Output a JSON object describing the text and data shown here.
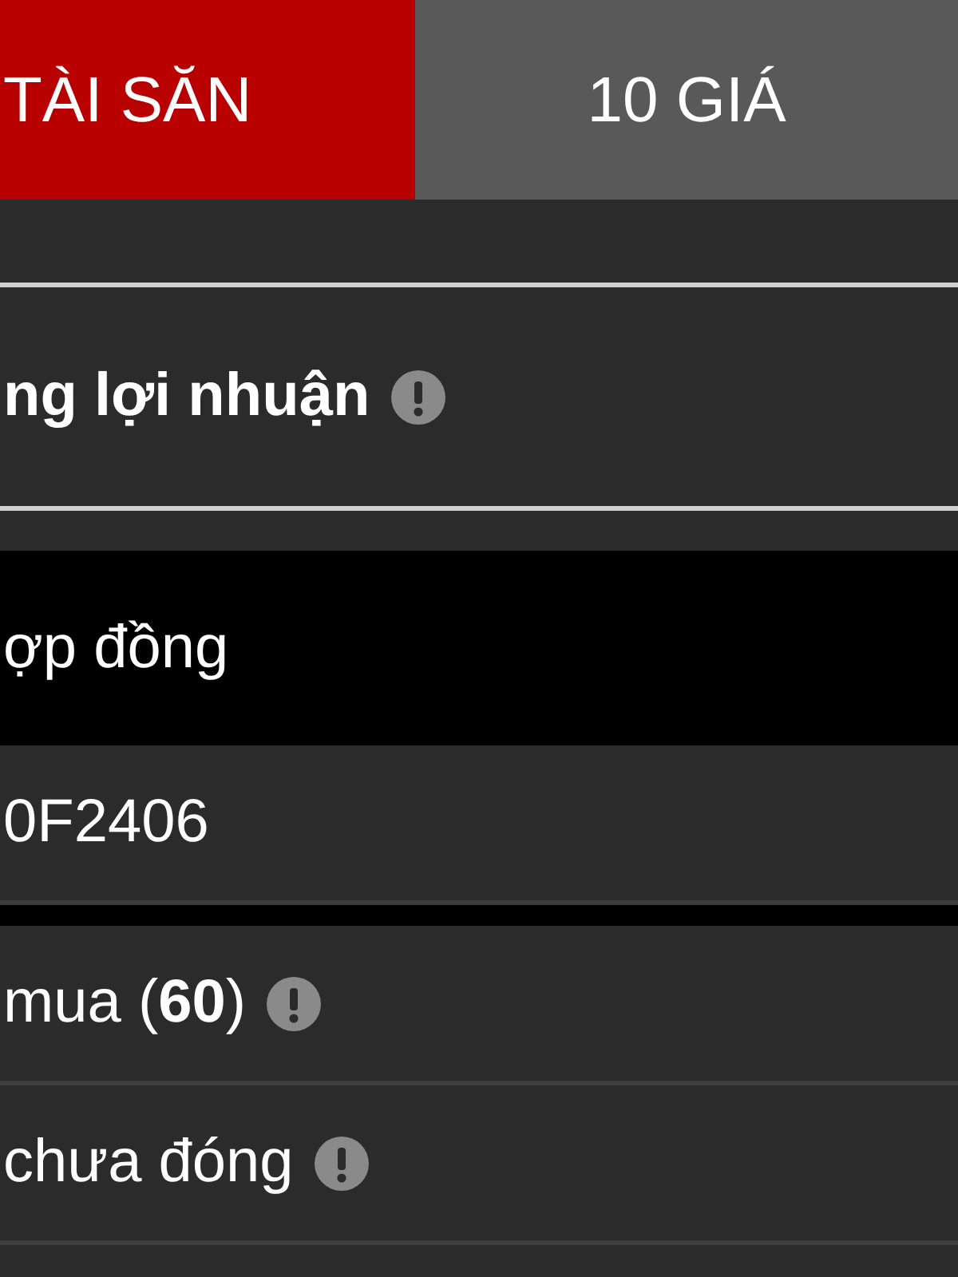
{
  "tabs": [
    {
      "label": "TÀI SĂN",
      "selected": true
    },
    {
      "label": "10 GIÁ",
      "selected": false
    }
  ],
  "rows": [
    {
      "kind": "header",
      "text": "ng lợi nhuận",
      "info": true
    },
    {
      "kind": "dark",
      "text": "ợp đồng",
      "info": false
    },
    {
      "kind": "value",
      "text": "0F2406",
      "info": false
    },
    {
      "kind": "value",
      "text": "mua (**60**)",
      "info": true
    },
    {
      "kind": "value",
      "text": "chưa đóng",
      "info": true
    }
  ]
}
